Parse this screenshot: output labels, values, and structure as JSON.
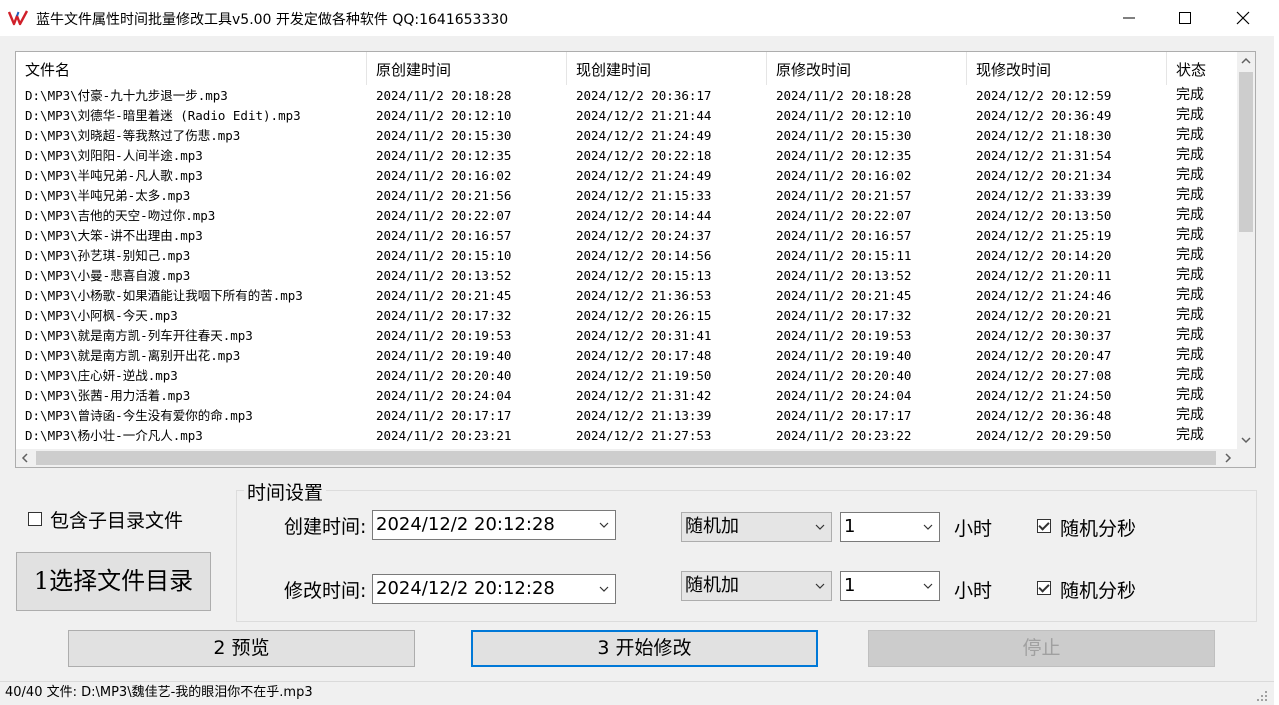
{
  "window": {
    "title": "蓝牛文件属性时间批量修改工具v5.00  开发定做各种软件  QQ:1641653330"
  },
  "list": {
    "columns": [
      "文件名",
      "原创建时间",
      "现创建时间",
      "原修改时间",
      "现修改时间",
      "状态"
    ],
    "rows": [
      [
        "D:\\MP3\\付豪-九十九步退一步.mp3",
        "2024/11/2 20:18:28",
        "2024/12/2 20:36:17",
        "2024/11/2 20:18:28",
        "2024/12/2 20:12:59",
        "完成"
      ],
      [
        "D:\\MP3\\刘德华-暗里着迷 (Radio Edit).mp3",
        "2024/11/2 20:12:10",
        "2024/12/2 21:21:44",
        "2024/11/2 20:12:10",
        "2024/12/2 20:36:49",
        "完成"
      ],
      [
        "D:\\MP3\\刘晓超-等我熬过了伤悲.mp3",
        "2024/11/2 20:15:30",
        "2024/12/2 21:24:49",
        "2024/11/2 20:15:30",
        "2024/12/2 21:18:30",
        "完成"
      ],
      [
        "D:\\MP3\\刘阳阳-人间半途.mp3",
        "2024/11/2 20:12:35",
        "2024/12/2 20:22:18",
        "2024/11/2 20:12:35",
        "2024/12/2 21:31:54",
        "完成"
      ],
      [
        "D:\\MP3\\半吨兄弟-凡人歌.mp3",
        "2024/11/2 20:16:02",
        "2024/12/2 21:24:49",
        "2024/11/2 20:16:02",
        "2024/12/2 20:21:34",
        "完成"
      ],
      [
        "D:\\MP3\\半吨兄弟-太多.mp3",
        "2024/11/2 20:21:56",
        "2024/12/2 21:15:33",
        "2024/11/2 20:21:57",
        "2024/12/2 21:33:39",
        "完成"
      ],
      [
        "D:\\MP3\\吉他的天空-吻过你.mp3",
        "2024/11/2 20:22:07",
        "2024/12/2 20:14:44",
        "2024/11/2 20:22:07",
        "2024/12/2 20:13:50",
        "完成"
      ],
      [
        "D:\\MP3\\大笨-讲不出理由.mp3",
        "2024/11/2 20:16:57",
        "2024/12/2 20:24:37",
        "2024/11/2 20:16:57",
        "2024/12/2 21:25:19",
        "完成"
      ],
      [
        "D:\\MP3\\孙艺琪-别知己.mp3",
        "2024/11/2 20:15:10",
        "2024/12/2 20:14:56",
        "2024/11/2 20:15:11",
        "2024/12/2 20:14:20",
        "完成"
      ],
      [
        "D:\\MP3\\小曼-悲喜自渡.mp3",
        "2024/11/2 20:13:52",
        "2024/12/2 20:15:13",
        "2024/11/2 20:13:52",
        "2024/12/2 21:20:11",
        "完成"
      ],
      [
        "D:\\MP3\\小杨歌-如果酒能让我咽下所有的苦.mp3",
        "2024/11/2 20:21:45",
        "2024/12/2 21:36:53",
        "2024/11/2 20:21:45",
        "2024/12/2 21:24:46",
        "完成"
      ],
      [
        "D:\\MP3\\小阿枫-今天.mp3",
        "2024/11/2 20:17:32",
        "2024/12/2 20:26:15",
        "2024/11/2 20:17:32",
        "2024/12/2 20:20:21",
        "完成"
      ],
      [
        "D:\\MP3\\就是南方凯-列车开往春天.mp3",
        "2024/11/2 20:19:53",
        "2024/12/2 20:31:41",
        "2024/11/2 20:19:53",
        "2024/12/2 20:30:37",
        "完成"
      ],
      [
        "D:\\MP3\\就是南方凯-离别开出花.mp3",
        "2024/11/2 20:19:40",
        "2024/12/2 20:17:48",
        "2024/11/2 20:19:40",
        "2024/12/2 20:20:47",
        "完成"
      ],
      [
        "D:\\MP3\\庄心妍-逆战.mp3",
        "2024/11/2 20:20:40",
        "2024/12/2 21:19:50",
        "2024/11/2 20:20:40",
        "2024/12/2 20:27:08",
        "完成"
      ],
      [
        "D:\\MP3\\张茜-用力活着.mp3",
        "2024/11/2 20:24:04",
        "2024/12/2 21:31:42",
        "2024/11/2 20:24:04",
        "2024/12/2 21:24:50",
        "完成"
      ],
      [
        "D:\\MP3\\曾诗函-今生没有爱你的命.mp3",
        "2024/11/2 20:17:17",
        "2024/12/2 21:13:39",
        "2024/11/2 20:17:17",
        "2024/12/2 20:36:48",
        "完成"
      ],
      [
        "D:\\MP3\\杨小壮-一介凡人.mp3",
        "2024/11/2 20:23:21",
        "2024/12/2 21:27:53",
        "2024/11/2 20:23:22",
        "2024/12/2 20:29:50",
        "完成"
      ]
    ]
  },
  "options": {
    "include_subdirs_label": "包含子目录文件",
    "include_subdirs_checked": false,
    "select_dir_button": "1选择文件目录"
  },
  "time_settings": {
    "group_title": "时间设置",
    "create_label": "创建时间:",
    "create_value": "2024/12/2 20:12:28",
    "create_mode": "随机加",
    "create_amount": "1",
    "create_unit": "小时",
    "create_random_label": "随机分秒",
    "create_random_checked": true,
    "modify_label": "修改时间:",
    "modify_value": "2024/12/2 20:12:28",
    "modify_mode": "随机加",
    "modify_amount": "1",
    "modify_unit": "小时",
    "modify_random_label": "随机分秒",
    "modify_random_checked": true
  },
  "actions": {
    "preview": "2 预览",
    "start": "3 开始修改",
    "stop": "停止"
  },
  "status": {
    "text": "40/40 文件: D:\\MP3\\魏佳艺-我的眼泪你不在乎.mp3"
  }
}
